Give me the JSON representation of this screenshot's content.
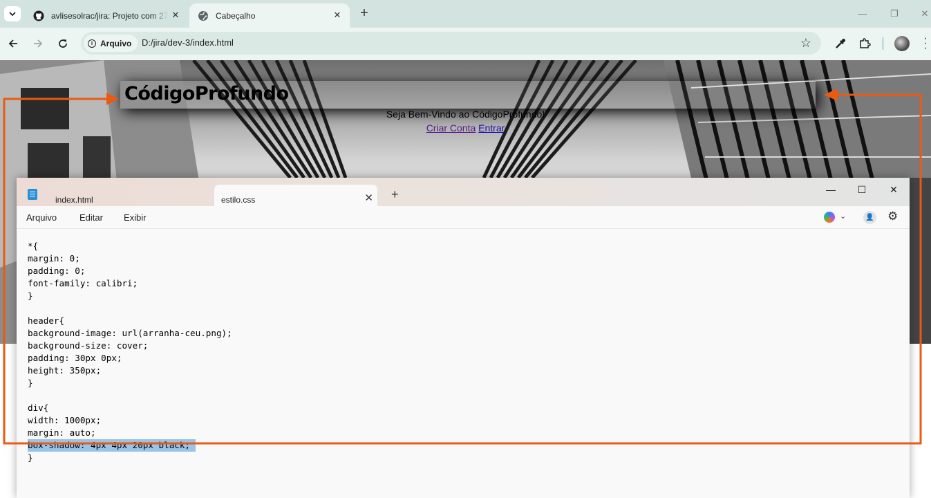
{
  "browser": {
    "tabs": [
      {
        "title": "avlisesolrac/jira: Projeto com 27",
        "icon": "github-icon",
        "active": false
      },
      {
        "title": "Cabeçalho",
        "icon": "globe-icon",
        "active": true
      }
    ],
    "address": {
      "security_chip": "Arquivo",
      "url": "D:/jira/dev-3/index.html"
    }
  },
  "webpage": {
    "site_title": "CódigoProfundo",
    "welcome_text": "Seja Bem-Vindo ao CódigoProfundo!",
    "links": [
      "Criar Conta",
      "Entrar"
    ]
  },
  "notepad": {
    "tabs": [
      "index.html",
      "estilo.css"
    ],
    "active_tab": "estilo.css",
    "menu": [
      "Arquivo",
      "Editar",
      "Exibir"
    ],
    "code_lines": [
      "*{",
      "margin: 0;",
      "padding: 0;",
      "font-family: calibri;",
      "}",
      "",
      "header{",
      "background-image: url(arranha-ceu.png);",
      "background-size: cover;",
      "padding: 30px 0px;",
      "height: 350px;",
      "}",
      "",
      "div{",
      "width: 1000px;",
      "margin: auto;",
      "box-shadow: 4px 4px 20px black;",
      "}"
    ],
    "selected_line": 16
  },
  "colors": {
    "annotation": "#ea5a12",
    "selection": "#99c4ea",
    "chrome_tabstrip": "#d3e3df"
  }
}
